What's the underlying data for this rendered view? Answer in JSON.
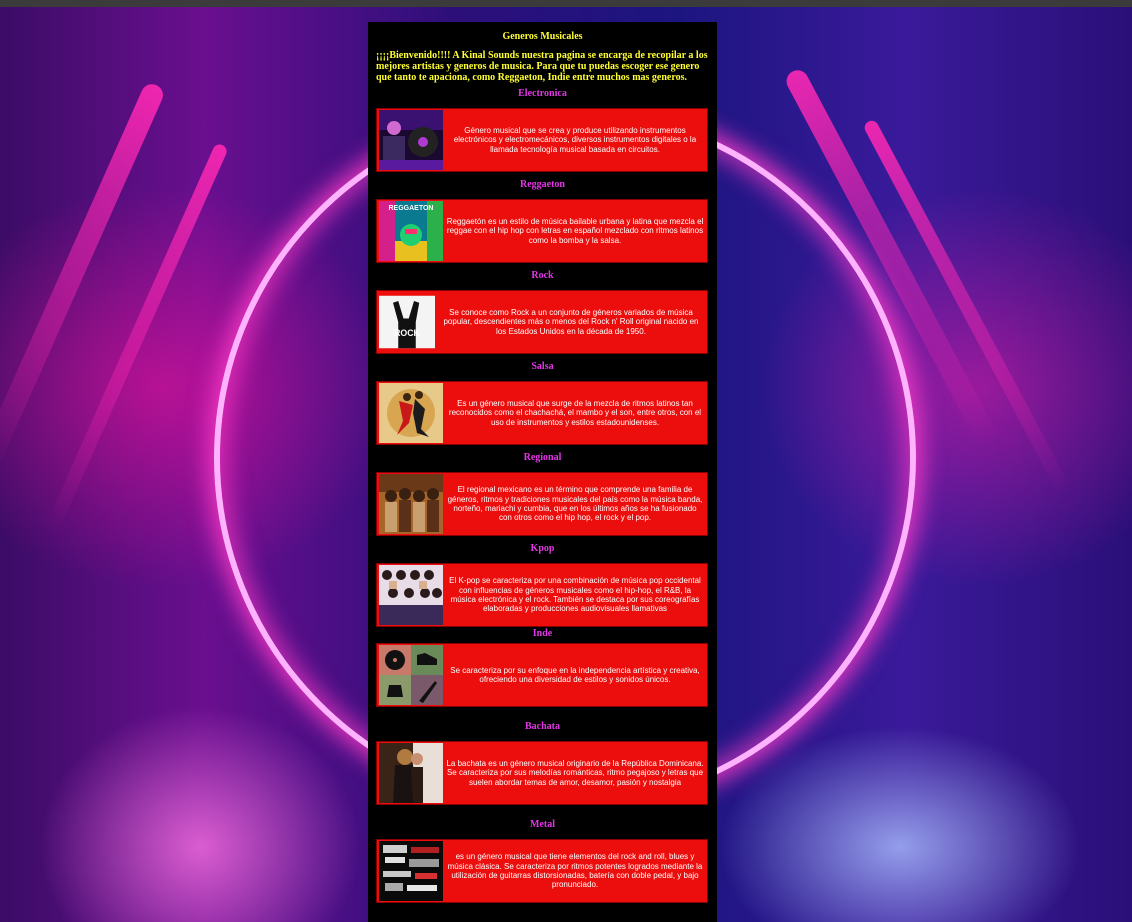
{
  "page": {
    "title": "Generos Musicales",
    "intro": "¡¡¡¡Bienvenido!!!! A Kinal Sounds nuestra pagina se encarga de recopilar a los mejores artistas y generos de musica. Para que tu puedas escoger ese genero que tanto te apaciona, como Reggaeton, Indie entre muchos mas generos."
  },
  "genres": [
    {
      "name": "Electronica",
      "description": "Género musical que se crea y produce utilizando instrumentos electrónicos y electromecánicos, diversos instrumentos digitales o la llamada tecnología musical basada en circuitos."
    },
    {
      "name": "Reggaeton",
      "image_label": "REGGAETON",
      "description": "Reggaetón es un estilo de música bailable urbana y latina que mezcla el reggae con el hip hop con letras en español mezclado con ritmos latinos como la bomba y la salsa."
    },
    {
      "name": "Rock",
      "image_label": "ROCK",
      "description": "Se conoce como Rock a un conjunto de géneros variados de música popular, descendientes más o menos del Rock n' Roll original nacido en los Estados Unidos en la década de 1950."
    },
    {
      "name": "Salsa",
      "description": "Es un género musical que surge de la mezcla de ritmos latinos tan reconocidos como el chachachá, el mambo y el son, entre otros, con el uso de instrumentos y estilos estadounidenses."
    },
    {
      "name": "Regional",
      "description": "El regional mexicano es un término que comprende una familia de géneros, ritmos y tradiciones musicales del país como la música banda, norteño, mariachi y cumbia, que en los últimos años se ha fusionado con otros como el hip hop, el rock y el pop."
    },
    {
      "name": "Kpop",
      "description": "El K-pop se caracteriza por una combinación de música pop occidental con influencias de géneros musicales como el hip-hop, el R&B, la música electrónica y el rock. También se destaca por sus coreografías elaboradas y producciones audiovisuales llamativas"
    },
    {
      "name": "Inde",
      "description": "Se caracteriza por su enfoque en la independencia artística y creativa, ofreciendo una diversidad de estilos y sonidos únicos."
    },
    {
      "name": "Bachata",
      "description": "La bachata es un género musical originario de la República Dominicana. Se caracteriza por sus melodías románticas, ritmo pegajoso y letras que suelen abordar temas de amor, desamor, pasión y nostalgia"
    },
    {
      "name": "Metal",
      "description": "es un género musical que tiene elementos del rock and roll, blues y música clásica. Se caracteriza por ritmos potentes logrados mediante la utilización de guitarras distorsionadas, batería con doble pedal, y bajo pronunciado."
    }
  ],
  "colors": {
    "heading": "#ffff33",
    "genre_title": "#e236e6",
    "card_bg": "#ec0d0d",
    "panel_bg": "#000000"
  }
}
